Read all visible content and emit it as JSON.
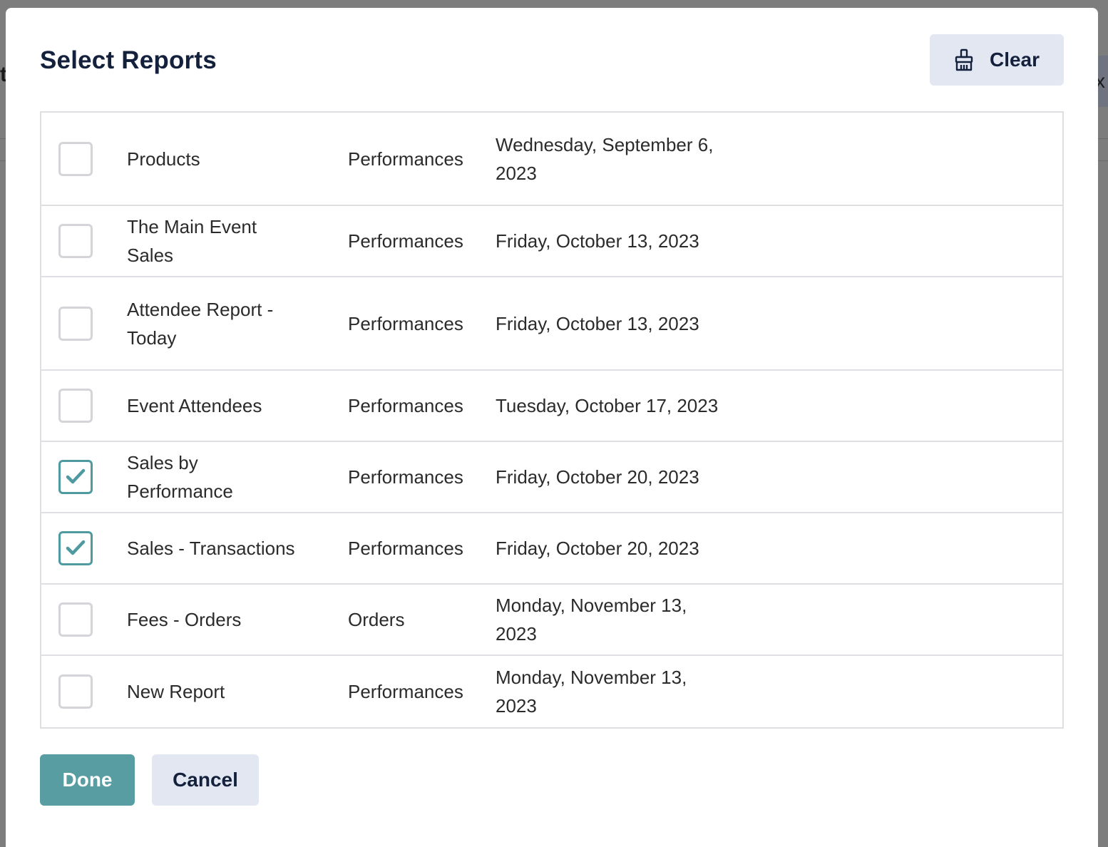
{
  "background": {
    "left_fragment": "t",
    "right_fragment": "x"
  },
  "modal": {
    "title": "Select Reports",
    "clear_label": "Clear",
    "clear_icon": "broom-icon",
    "done_label": "Done",
    "cancel_label": "Cancel",
    "accent_color": "#579da1",
    "title_color": "#14213d"
  },
  "reports": [
    {
      "name": "Products",
      "type": "Performances",
      "date": "Wednesday, September 6, 2023",
      "checked": false
    },
    {
      "name": "The Main Event Sales",
      "type": "Performances",
      "date": "Friday, October 13, 2023",
      "checked": false
    },
    {
      "name": "Attendee Report - Today",
      "type": "Performances",
      "date": "Friday, October 13, 2023",
      "checked": false
    },
    {
      "name": "Event Attendees",
      "type": "Performances",
      "date": "Tuesday, October 17, 2023",
      "checked": false
    },
    {
      "name": "Sales by Performance",
      "type": "Performances",
      "date": "Friday, October 20, 2023",
      "checked": true
    },
    {
      "name": "Sales - Transactions",
      "type": "Performances",
      "date": "Friday, October 20, 2023",
      "checked": true
    },
    {
      "name": "Fees - Orders",
      "type": "Orders",
      "date": "Monday, November 13, 2023",
      "checked": false
    },
    {
      "name": "New Report",
      "type": "Performances",
      "date": "Monday, November 13, 2023",
      "checked": false
    }
  ]
}
